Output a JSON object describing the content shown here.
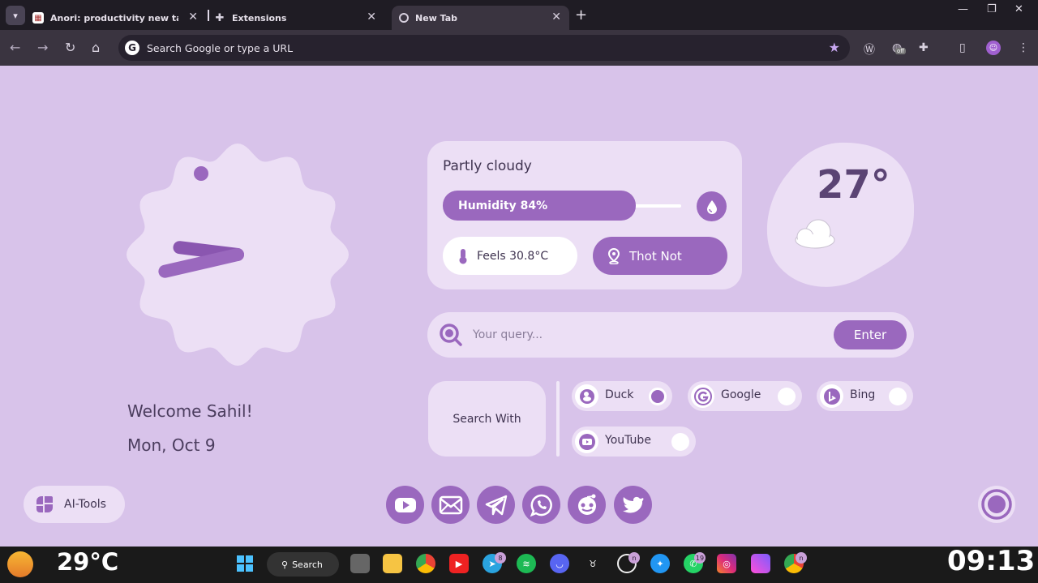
{
  "browser": {
    "tabs": [
      {
        "title": "Anori: productivity new tab - C",
        "active": false
      },
      {
        "title": "Extensions",
        "active": false
      },
      {
        "title": "New Tab",
        "active": true
      }
    ],
    "omnibox_placeholder": "Search Google or type a URL",
    "extension_badge": "off"
  },
  "clock": {
    "hour_hand_deg": 277,
    "minute_hand_deg": 257
  },
  "greeting": {
    "welcome": "Welcome Sahil!",
    "date": "Mon, Oct 9"
  },
  "weather": {
    "condition": "Partly cloudy",
    "humidity_label": "Humidity 84%",
    "humidity_percent": 84,
    "feels_like": "Feels 30.8°C",
    "location": "Thot Not",
    "temperature": "27°"
  },
  "search": {
    "placeholder": "Your query...",
    "enter_label": "Enter",
    "search_with_label": "Search With",
    "engines": [
      {
        "name": "Duck",
        "selected": true,
        "icon": "duck-icon"
      },
      {
        "name": "Google",
        "selected": false,
        "icon": "google-icon"
      },
      {
        "name": "Bing",
        "selected": false,
        "icon": "bing-icon"
      },
      {
        "name": "YouTube",
        "selected": false,
        "icon": "youtube-icon"
      }
    ]
  },
  "bottom": {
    "ai_tools_label": "AI-Tools",
    "social_icons": [
      "youtube-icon",
      "mail-icon",
      "telegram-icon",
      "whatsapp-icon",
      "reddit-icon",
      "twitter-icon"
    ]
  },
  "taskbar": {
    "temperature": "29°C",
    "search_label": "Search",
    "time": "09:13",
    "badges": [
      "8",
      "19",
      "n",
      "n"
    ]
  },
  "colors": {
    "accent": "#9a68be",
    "background": "#d8c3ea",
    "card": "#ecdff5"
  }
}
